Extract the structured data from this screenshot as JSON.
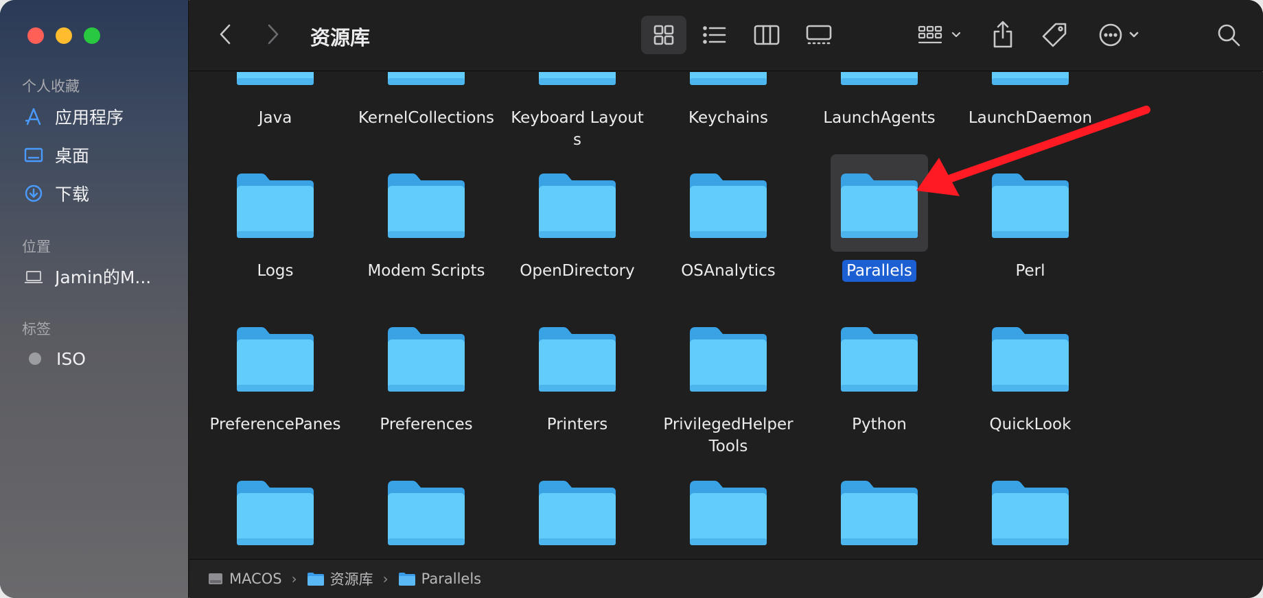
{
  "window": {
    "title": "资源库"
  },
  "sidebar": {
    "favorites_header": "个人收藏",
    "favorites": [
      {
        "label": "应用程序",
        "icon": "applications-icon"
      },
      {
        "label": "桌面",
        "icon": "desktop-icon"
      },
      {
        "label": "下载",
        "icon": "downloads-icon"
      }
    ],
    "locations_header": "位置",
    "locations": [
      {
        "label": "Jamin的M...",
        "icon": "laptop-icon"
      }
    ],
    "tags_header": "标签",
    "tags": [
      {
        "label": "ISO",
        "color": "#9c9da1"
      }
    ]
  },
  "toolbar": {
    "view_modes": [
      "icon-view",
      "list-view",
      "column-view",
      "gallery-view"
    ],
    "active_view": "icon-view"
  },
  "rows": [
    [
      "Java",
      "KernelCollections",
      "Keyboard Layouts",
      "Keychains",
      "LaunchAgents",
      "LaunchDaemon"
    ],
    [
      "Logs",
      "Modem Scripts",
      "OpenDirectory",
      "OSAnalytics",
      "Parallels",
      "Perl"
    ],
    [
      "PreferencePanes",
      "Preferences",
      "Printers",
      "PrivilegedHelperTools",
      "Python",
      "QuickLook"
    ],
    [
      "",
      "",
      "",
      "",
      "",
      ""
    ]
  ],
  "selected": "Parallels",
  "pathbar": [
    "MACOS",
    "资源库",
    "Parallels"
  ],
  "colors": {
    "accent": "#1c5fd3",
    "folder": "#5ac8fa",
    "annotation_arrow": "#ff1a24"
  }
}
